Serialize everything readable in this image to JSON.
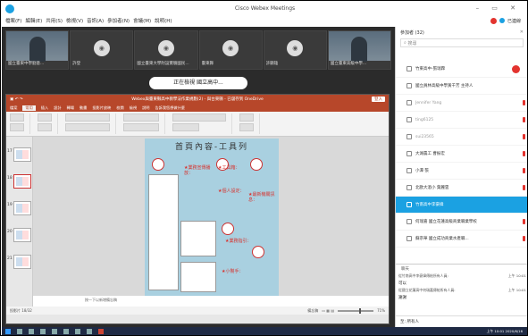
{
  "window": {
    "title": "Cisco Webex Meetings"
  },
  "menu": {
    "items": [
      "檔案(F)",
      "編輯(E)",
      "共用(S)",
      "檢視(V)",
      "音訊(A)",
      "參加者(N)",
      "會議(M)",
      "說明(H)"
    ],
    "right_label": "已連線"
  },
  "thumbnails": [
    {
      "name": "國立臺東中學劉意...",
      "kind": "video"
    },
    {
      "name": "許登",
      "kind": "avatar"
    },
    {
      "name": "國立臺東大學附設實驗國民...",
      "kind": "avatar"
    },
    {
      "name": "臺東縣",
      "kind": "avatar"
    },
    {
      "name": "許顯雄",
      "kind": "avatar"
    },
    {
      "name": "國立臺東高級中學...",
      "kind": "video"
    }
  ],
  "banner": {
    "text": "正在檢視 國立高中..."
  },
  "ppt": {
    "title": "Webex與臺東縣高中教學法作業規劃(2) - 與台東縣 - 已儲存到 OneDrive",
    "login": "登入",
    "tabs": [
      "檔案",
      "常用",
      "插入",
      "設計",
      "轉場",
      "動畫",
      "投影片放映",
      "校閱",
      "檢視",
      "說明",
      "告訴我您想做什麼"
    ],
    "slide": {
      "heading": "首頁內容-工具列",
      "labels": [
        "★業務宣傳播放：",
        "★工具箱：",
        "★個人設定：",
        "★業務指引：",
        "★小幫手：",
        "★最新機關訊息："
      ]
    },
    "slide_numbers": [
      "17",
      "18",
      "19",
      "20",
      "21"
    ],
    "notes_placeholder": "按一下以新增備忘稿",
    "status_left": "投影片 18/32",
    "status_right": "備忘稿",
    "zoom": "71%"
  },
  "taskbar": {
    "clock": "上午 10:01 2020/6/16"
  },
  "panel": {
    "header": "參加者 (32)",
    "search_placeholder": "搜尋",
    "participants": [
      {
        "name": "竹東高中-張瑞霖",
        "selected": false,
        "grey": false
      },
      {
        "name": "國立員林高級中學黃千芳 主持人",
        "selected": false,
        "grey": false
      },
      {
        "name": "Jennifer Yang",
        "selected": false,
        "grey": true
      },
      {
        "name": "ting6125",
        "selected": false,
        "grey": true
      },
      {
        "name": "sui23565",
        "selected": false,
        "grey": true
      },
      {
        "name": "大湖農工 曹振宏",
        "selected": false,
        "grey": false
      },
      {
        "name": "小潭 張",
        "selected": false,
        "grey": false
      },
      {
        "name": "北歐大酒小 葉麗雲",
        "selected": false,
        "grey": false
      },
      {
        "name": "竹南高中李豪緯",
        "selected": true,
        "grey": false
      },
      {
        "name": "何瑞嘉 國立花蓮高級商業職業學校",
        "selected": false,
        "grey": false
      },
      {
        "name": "蘇宗華 國立成功商業水產職...",
        "selected": false,
        "grey": false
      }
    ],
    "chat": {
      "header": "聊天",
      "messages": [
        {
          "from": "從竹南高中李豪緯傳給所有人員:",
          "time": "上午 10:01",
          "text": "可以"
        },
        {
          "from": "從國立花蓮高中何瑞嘉傳給所有人員:",
          "time": "上午 10:01",
          "text": "謝謝"
        }
      ],
      "to_label": "至:",
      "to_value": "所有人"
    }
  }
}
